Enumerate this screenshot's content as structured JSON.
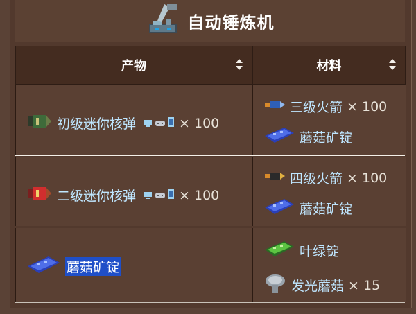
{
  "title": "自动锤炼机",
  "headers": {
    "product": "产物",
    "materials": "材料"
  },
  "rows": [
    {
      "product": {
        "name": "初级迷你核弹",
        "qty": "× 100"
      },
      "materials": [
        {
          "name": "三级火箭",
          "qty": "× 100"
        },
        {
          "name": "蘑菇矿锭",
          "qty": ""
        }
      ]
    },
    {
      "product": {
        "name": "二级迷你核弹",
        "qty": "× 100"
      },
      "materials": [
        {
          "name": "四级火箭",
          "qty": "× 100"
        },
        {
          "name": "蘑菇矿锭",
          "qty": ""
        }
      ]
    },
    {
      "product": {
        "name": "蘑菇矿锭",
        "qty": ""
      },
      "materials": [
        {
          "name": "叶绿锭",
          "qty": ""
        },
        {
          "name": "发光蘑菇",
          "qty": "× 15"
        }
      ]
    }
  ],
  "icons": {
    "title": "autohammer-icon",
    "platforms": [
      "desktop-icon",
      "console-icon",
      "mobile-icon"
    ],
    "sort": "sort-arrows-icon"
  },
  "colors": {
    "link": "#bfe6ff",
    "highlight": "#1f4fc8",
    "header_bg": "#442c20",
    "cell_bg": "#5a4033"
  }
}
